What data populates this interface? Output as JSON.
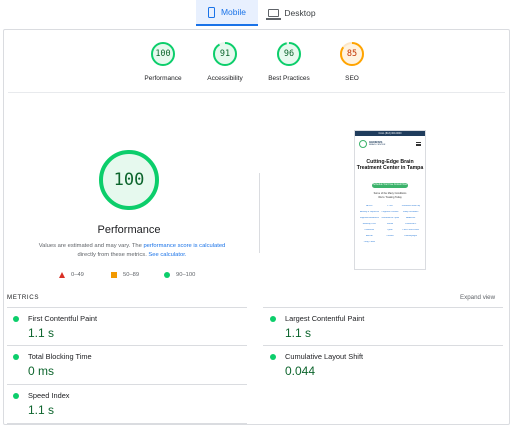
{
  "tabs": [
    {
      "label": "Mobile",
      "icon": "smartphone-icon",
      "active": true
    },
    {
      "label": "Desktop",
      "icon": "laptop-icon",
      "active": false
    }
  ],
  "summary": [
    {
      "label": "Performance",
      "score": "100",
      "color": "#0cce6b"
    },
    {
      "label": "Accessibility",
      "score": "91",
      "color": "#0cce6b"
    },
    {
      "label": "Best Practices",
      "score": "96",
      "color": "#0cce6b"
    },
    {
      "label": "SEO",
      "score": "85",
      "color": "#ffa400"
    }
  ],
  "performance": {
    "score": "100",
    "title": "Performance",
    "desc_1": "Values are estimated and may vary. The ",
    "desc_link_1": "performance score is calculated",
    "desc_2": " directly from these metrics. ",
    "desc_link_2": "See calculator."
  },
  "legend": [
    {
      "range": "0–49",
      "color": "#d93025",
      "shape": "triangle"
    },
    {
      "range": "50–89",
      "color": "#f29900",
      "shape": "square"
    },
    {
      "range": "90–100",
      "color": "#0cce6b",
      "shape": "circle"
    }
  ],
  "screenshot": {
    "topbar": "CALL (813) 000-0000",
    "logo_line1": "GENESIS",
    "logo_line2": "BRAIN CENTER",
    "heading_1": "Cutting-Edge Brain",
    "heading_2": "Treatment Center in Tampa",
    "button": "Schedule Your Free Consult Now",
    "sub_1": "Some of the Many Conditions",
    "sub_2": "We're Treating Today",
    "links": [
      "ADHD",
      "PTSD",
      "Traumatic Brain Injury",
      "Anxiety & Depression",
      "Cognitive Decline",
      "Sleep Disorders",
      "Migraine/Headaches",
      "Performance Optimization",
      "Addiction",
      "Memory Loss",
      "Stroke",
      "Parkinson's",
      "Dementia",
      "Lyme",
      "Post-Concussion",
      "Autism",
      "Tinnitus",
      "Fibromyalgia",
      "Long Covid"
    ]
  },
  "metrics": {
    "label": "METRICS",
    "expand": "Expand view",
    "items": [
      {
        "name": "First Contentful Paint",
        "value": "1.1 s",
        "color": "#0cce6b"
      },
      {
        "name": "Largest Contentful Paint",
        "value": "1.1 s",
        "color": "#0cce6b"
      },
      {
        "name": "Total Blocking Time",
        "value": "0 ms",
        "color": "#0cce6b"
      },
      {
        "name": "Cumulative Layout Shift",
        "value": "0.044",
        "color": "#0cce6b"
      },
      {
        "name": "Speed Index",
        "value": "1.1 s",
        "color": "#0cce6b"
      }
    ]
  }
}
